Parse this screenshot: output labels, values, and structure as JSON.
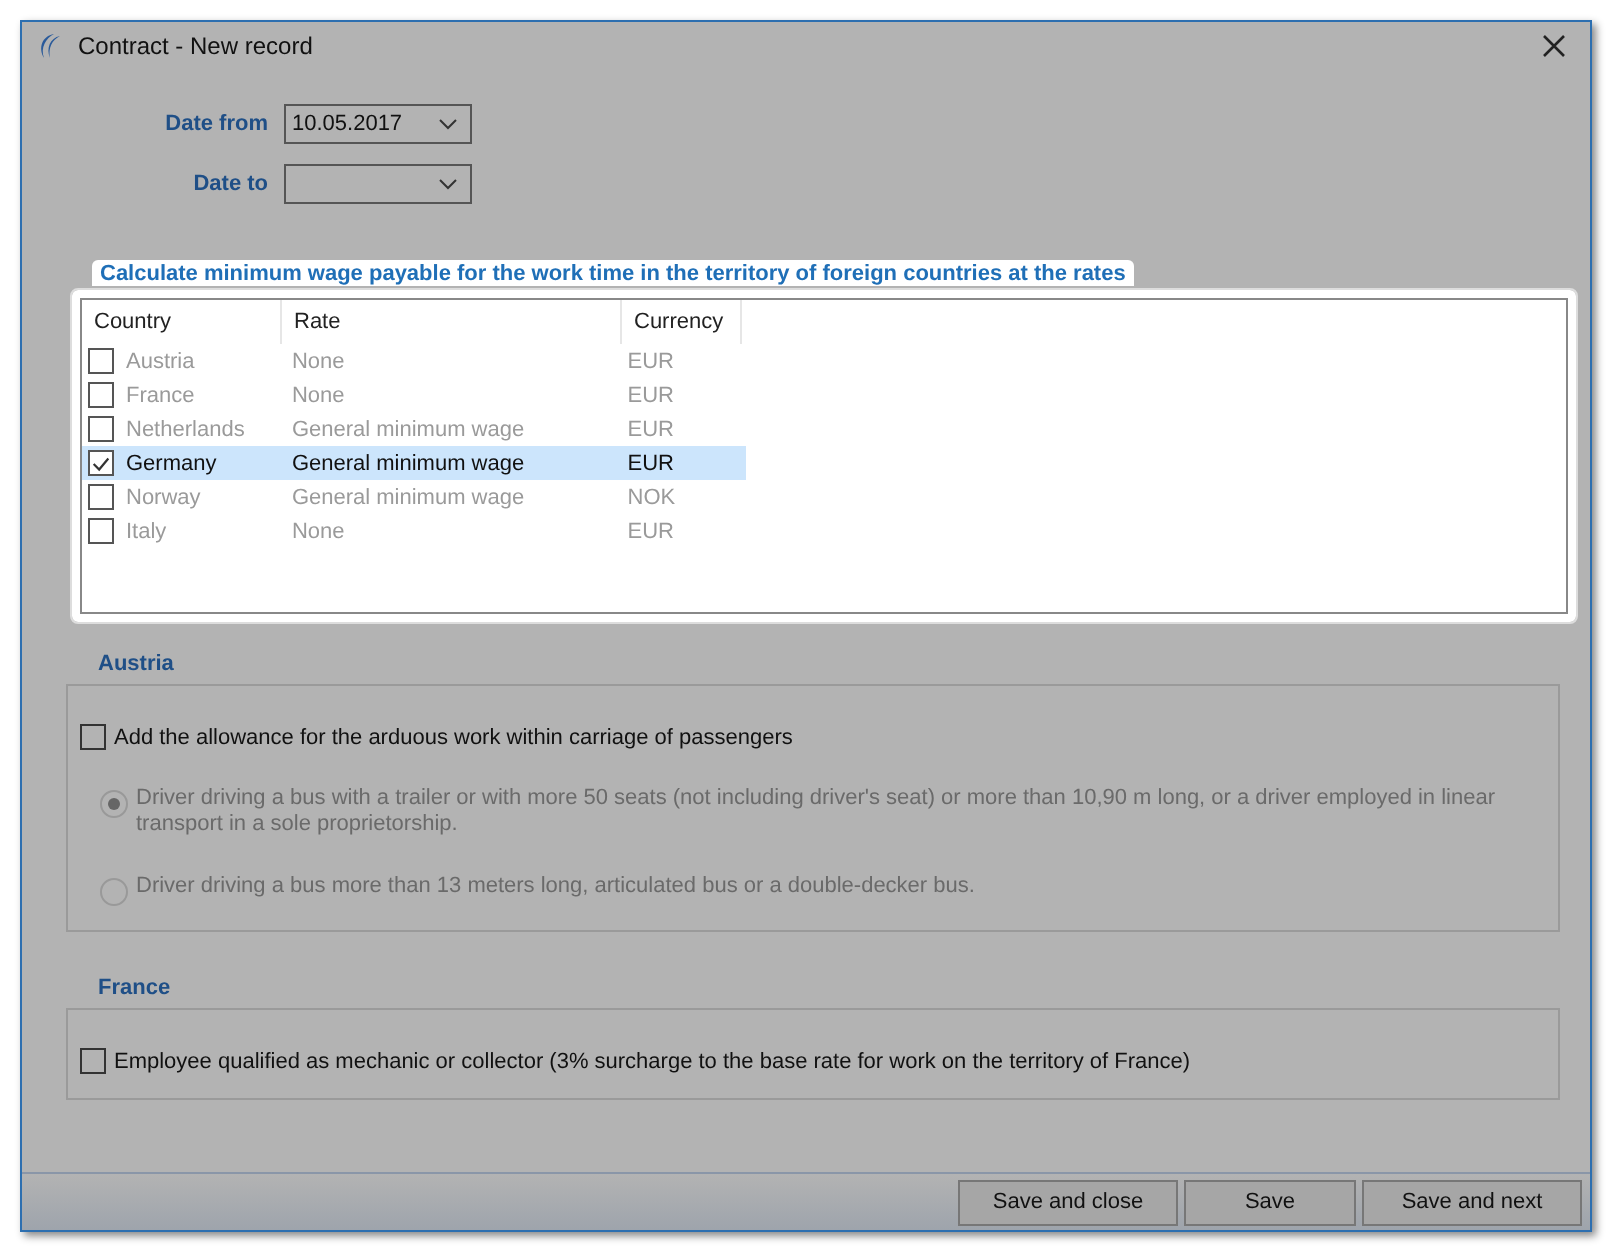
{
  "window": {
    "title": "Contract - New record"
  },
  "date_from": {
    "label": "Date from",
    "value": "10.05.2017"
  },
  "date_to": {
    "label": "Date to"
  },
  "countries": {
    "title": "Calculate minimum wage payable for the work time in the territory of foreign countries at the rates",
    "columns": [
      "Country",
      "Rate",
      "Currency"
    ],
    "rows": [
      {
        "country": "Austria",
        "rate": "None",
        "currency": "EUR",
        "checked": false,
        "selected": false
      },
      {
        "country": "France",
        "rate": "None",
        "currency": "EUR",
        "checked": false,
        "selected": false
      },
      {
        "country": "Netherlands",
        "rate": "General minimum wage",
        "currency": "EUR",
        "checked": false,
        "selected": false
      },
      {
        "country": "Germany",
        "rate": "General minimum wage",
        "currency": "EUR",
        "checked": true,
        "selected": true
      },
      {
        "country": "Norway",
        "rate": "General minimum wage",
        "currency": "NOK",
        "checked": false,
        "selected": false
      },
      {
        "country": "Italy",
        "rate": "None",
        "currency": "EUR",
        "checked": false,
        "selected": false
      }
    ]
  },
  "sections": [
    {
      "title": "Austria",
      "option": {
        "label": "Add the allowance for the arduous work within carriage of passengers",
        "checked": false
      },
      "radios": [
        {
          "label": "Driver driving a bus with a trailer or with more 50 seats (not including driver's seat) or more than 10,90 m long, or a driver employed in linear transport in a sole proprietorship.",
          "selected": true,
          "disabled": true
        },
        {
          "label": "Driver driving a bus more than 13 meters long, articulated bus or a double-decker bus.",
          "selected": false,
          "disabled": true
        }
      ]
    },
    {
      "title": "France",
      "option": {
        "label": "Employee qualified as mechanic or collector (3% surcharge to the base rate for work on the territory of France)",
        "checked": false
      }
    }
  ],
  "buttons": [
    "Save and close",
    "Save",
    "Save and next"
  ]
}
